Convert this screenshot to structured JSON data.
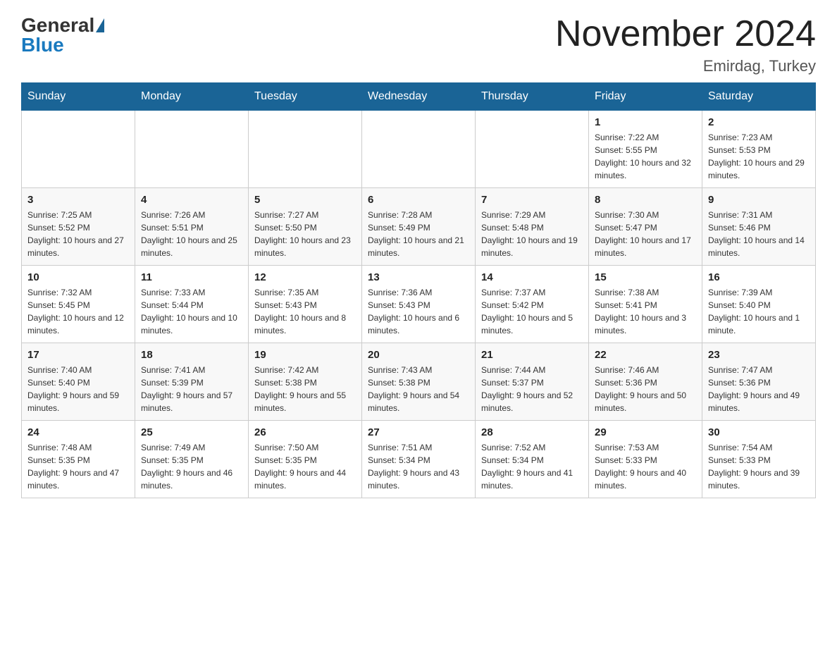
{
  "logo": {
    "text_general": "General",
    "text_blue": "Blue"
  },
  "header": {
    "month_year": "November 2024",
    "location": "Emirdag, Turkey"
  },
  "weekdays": [
    "Sunday",
    "Monday",
    "Tuesday",
    "Wednesday",
    "Thursday",
    "Friday",
    "Saturday"
  ],
  "weeks": [
    {
      "days": [
        {
          "num": "",
          "sunrise": "",
          "sunset": "",
          "daylight": ""
        },
        {
          "num": "",
          "sunrise": "",
          "sunset": "",
          "daylight": ""
        },
        {
          "num": "",
          "sunrise": "",
          "sunset": "",
          "daylight": ""
        },
        {
          "num": "",
          "sunrise": "",
          "sunset": "",
          "daylight": ""
        },
        {
          "num": "",
          "sunrise": "",
          "sunset": "",
          "daylight": ""
        },
        {
          "num": "1",
          "sunrise": "Sunrise: 7:22 AM",
          "sunset": "Sunset: 5:55 PM",
          "daylight": "Daylight: 10 hours and 32 minutes."
        },
        {
          "num": "2",
          "sunrise": "Sunrise: 7:23 AM",
          "sunset": "Sunset: 5:53 PM",
          "daylight": "Daylight: 10 hours and 29 minutes."
        }
      ]
    },
    {
      "days": [
        {
          "num": "3",
          "sunrise": "Sunrise: 7:25 AM",
          "sunset": "Sunset: 5:52 PM",
          "daylight": "Daylight: 10 hours and 27 minutes."
        },
        {
          "num": "4",
          "sunrise": "Sunrise: 7:26 AM",
          "sunset": "Sunset: 5:51 PM",
          "daylight": "Daylight: 10 hours and 25 minutes."
        },
        {
          "num": "5",
          "sunrise": "Sunrise: 7:27 AM",
          "sunset": "Sunset: 5:50 PM",
          "daylight": "Daylight: 10 hours and 23 minutes."
        },
        {
          "num": "6",
          "sunrise": "Sunrise: 7:28 AM",
          "sunset": "Sunset: 5:49 PM",
          "daylight": "Daylight: 10 hours and 21 minutes."
        },
        {
          "num": "7",
          "sunrise": "Sunrise: 7:29 AM",
          "sunset": "Sunset: 5:48 PM",
          "daylight": "Daylight: 10 hours and 19 minutes."
        },
        {
          "num": "8",
          "sunrise": "Sunrise: 7:30 AM",
          "sunset": "Sunset: 5:47 PM",
          "daylight": "Daylight: 10 hours and 17 minutes."
        },
        {
          "num": "9",
          "sunrise": "Sunrise: 7:31 AM",
          "sunset": "Sunset: 5:46 PM",
          "daylight": "Daylight: 10 hours and 14 minutes."
        }
      ]
    },
    {
      "days": [
        {
          "num": "10",
          "sunrise": "Sunrise: 7:32 AM",
          "sunset": "Sunset: 5:45 PM",
          "daylight": "Daylight: 10 hours and 12 minutes."
        },
        {
          "num": "11",
          "sunrise": "Sunrise: 7:33 AM",
          "sunset": "Sunset: 5:44 PM",
          "daylight": "Daylight: 10 hours and 10 minutes."
        },
        {
          "num": "12",
          "sunrise": "Sunrise: 7:35 AM",
          "sunset": "Sunset: 5:43 PM",
          "daylight": "Daylight: 10 hours and 8 minutes."
        },
        {
          "num": "13",
          "sunrise": "Sunrise: 7:36 AM",
          "sunset": "Sunset: 5:43 PM",
          "daylight": "Daylight: 10 hours and 6 minutes."
        },
        {
          "num": "14",
          "sunrise": "Sunrise: 7:37 AM",
          "sunset": "Sunset: 5:42 PM",
          "daylight": "Daylight: 10 hours and 5 minutes."
        },
        {
          "num": "15",
          "sunrise": "Sunrise: 7:38 AM",
          "sunset": "Sunset: 5:41 PM",
          "daylight": "Daylight: 10 hours and 3 minutes."
        },
        {
          "num": "16",
          "sunrise": "Sunrise: 7:39 AM",
          "sunset": "Sunset: 5:40 PM",
          "daylight": "Daylight: 10 hours and 1 minute."
        }
      ]
    },
    {
      "days": [
        {
          "num": "17",
          "sunrise": "Sunrise: 7:40 AM",
          "sunset": "Sunset: 5:40 PM",
          "daylight": "Daylight: 9 hours and 59 minutes."
        },
        {
          "num": "18",
          "sunrise": "Sunrise: 7:41 AM",
          "sunset": "Sunset: 5:39 PM",
          "daylight": "Daylight: 9 hours and 57 minutes."
        },
        {
          "num": "19",
          "sunrise": "Sunrise: 7:42 AM",
          "sunset": "Sunset: 5:38 PM",
          "daylight": "Daylight: 9 hours and 55 minutes."
        },
        {
          "num": "20",
          "sunrise": "Sunrise: 7:43 AM",
          "sunset": "Sunset: 5:38 PM",
          "daylight": "Daylight: 9 hours and 54 minutes."
        },
        {
          "num": "21",
          "sunrise": "Sunrise: 7:44 AM",
          "sunset": "Sunset: 5:37 PM",
          "daylight": "Daylight: 9 hours and 52 minutes."
        },
        {
          "num": "22",
          "sunrise": "Sunrise: 7:46 AM",
          "sunset": "Sunset: 5:36 PM",
          "daylight": "Daylight: 9 hours and 50 minutes."
        },
        {
          "num": "23",
          "sunrise": "Sunrise: 7:47 AM",
          "sunset": "Sunset: 5:36 PM",
          "daylight": "Daylight: 9 hours and 49 minutes."
        }
      ]
    },
    {
      "days": [
        {
          "num": "24",
          "sunrise": "Sunrise: 7:48 AM",
          "sunset": "Sunset: 5:35 PM",
          "daylight": "Daylight: 9 hours and 47 minutes."
        },
        {
          "num": "25",
          "sunrise": "Sunrise: 7:49 AM",
          "sunset": "Sunset: 5:35 PM",
          "daylight": "Daylight: 9 hours and 46 minutes."
        },
        {
          "num": "26",
          "sunrise": "Sunrise: 7:50 AM",
          "sunset": "Sunset: 5:35 PM",
          "daylight": "Daylight: 9 hours and 44 minutes."
        },
        {
          "num": "27",
          "sunrise": "Sunrise: 7:51 AM",
          "sunset": "Sunset: 5:34 PM",
          "daylight": "Daylight: 9 hours and 43 minutes."
        },
        {
          "num": "28",
          "sunrise": "Sunrise: 7:52 AM",
          "sunset": "Sunset: 5:34 PM",
          "daylight": "Daylight: 9 hours and 41 minutes."
        },
        {
          "num": "29",
          "sunrise": "Sunrise: 7:53 AM",
          "sunset": "Sunset: 5:33 PM",
          "daylight": "Daylight: 9 hours and 40 minutes."
        },
        {
          "num": "30",
          "sunrise": "Sunrise: 7:54 AM",
          "sunset": "Sunset: 5:33 PM",
          "daylight": "Daylight: 9 hours and 39 minutes."
        }
      ]
    }
  ]
}
